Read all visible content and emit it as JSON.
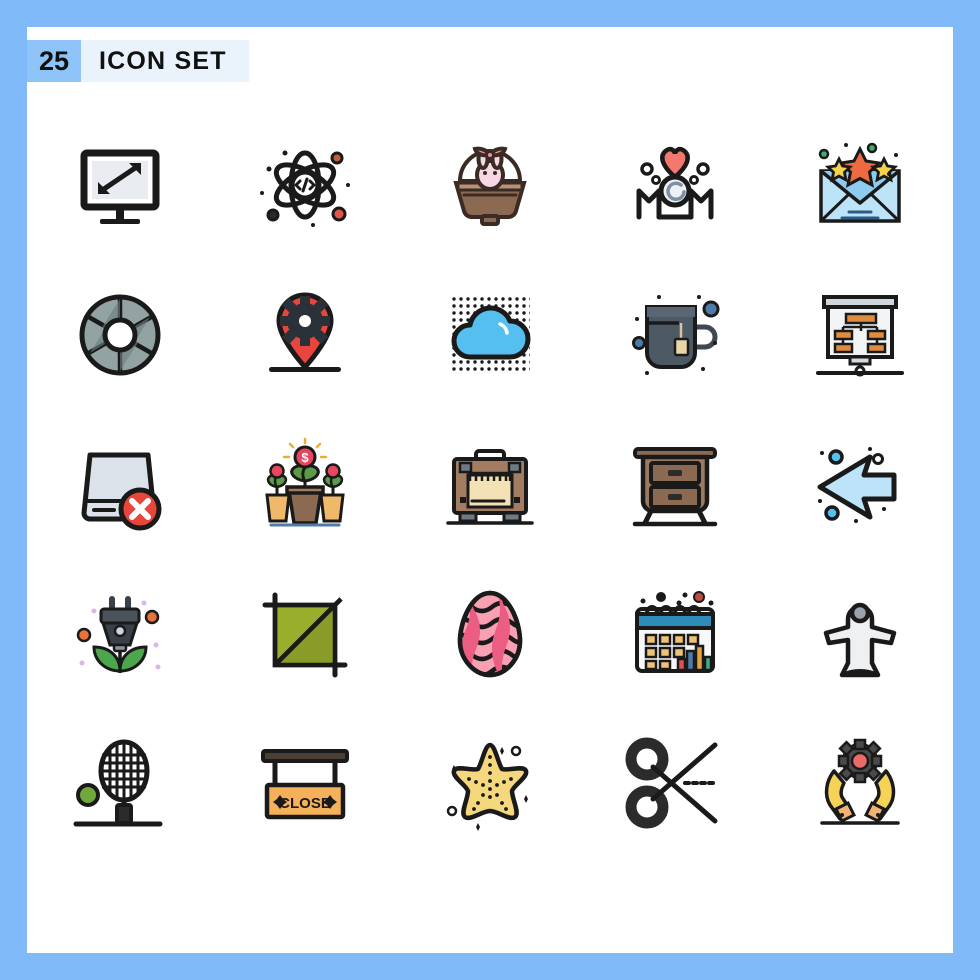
{
  "header": {
    "count": "25",
    "title": "ICON SET",
    "badge_bg": "#8FC4F8",
    "title_bg": "#EAF3FC",
    "text_color": "#111111"
  },
  "frame": {
    "border_color": "#7FB9F7",
    "canvas_color": "#FFFFFF",
    "border_width_px": 27
  },
  "palette": {
    "outline": "#1A1A1A",
    "red": "#E8453C",
    "coral": "#F4786E",
    "pink": "#F28FA0",
    "pink_light": "#F7AFBD",
    "blue_light": "#BDE3F8",
    "blue": "#55BFF0",
    "blue_mid": "#8ECBEE",
    "blue_steel": "#4E7BA8",
    "green": "#4CA64C",
    "olive": "#9AAE2E",
    "yellow": "#F5D77E",
    "orange": "#F5B05A",
    "orange_dark": "#D97B29",
    "brown": "#8C6A52",
    "brown_light": "#B89177",
    "tan": "#F3E2B6",
    "grey": "#8A9A9A",
    "grey_light": "#DDE3EA",
    "grey_dark": "#4A5560",
    "white": "#FFFFFF"
  },
  "grid": {
    "rows": 5,
    "cols": 5,
    "total": 25
  },
  "icons": [
    {
      "id": "screen-size",
      "name": "monitor-screen-size-icon",
      "row": 1,
      "col": 1
    },
    {
      "id": "atom-code",
      "name": "atom-code-icon",
      "row": 1,
      "col": 2
    },
    {
      "id": "easter-basket",
      "name": "easter-basket-bunny-icon",
      "row": 1,
      "col": 3
    },
    {
      "id": "mom-heart",
      "name": "mom-heart-icon",
      "row": 1,
      "col": 4
    },
    {
      "id": "mail-stars",
      "name": "mail-stars-icon",
      "row": 1,
      "col": 5
    },
    {
      "id": "aperture",
      "name": "camera-aperture-icon",
      "row": 2,
      "col": 1
    },
    {
      "id": "location-gear",
      "name": "location-pin-gear-icon",
      "row": 2,
      "col": 2
    },
    {
      "id": "cloud-dots",
      "name": "cloud-halftone-icon",
      "row": 2,
      "col": 3
    },
    {
      "id": "tea-mug",
      "name": "tea-mug-icon",
      "row": 2,
      "col": 4
    },
    {
      "id": "presentation-chart",
      "name": "presentation-flowchart-icon",
      "row": 2,
      "col": 5
    },
    {
      "id": "drive-delete",
      "name": "hard-drive-delete-icon",
      "row": 3,
      "col": 1
    },
    {
      "id": "money-plant",
      "name": "money-plant-icon",
      "row": 3,
      "col": 2
    },
    {
      "id": "toolbox",
      "name": "toolbox-case-icon",
      "row": 3,
      "col": 3
    },
    {
      "id": "nightstand",
      "name": "nightstand-drawers-icon",
      "row": 3,
      "col": 4
    },
    {
      "id": "arrow-left",
      "name": "arrow-left-icon",
      "row": 3,
      "col": 5
    },
    {
      "id": "eco-plug",
      "name": "eco-power-plug-icon",
      "row": 4,
      "col": 1
    },
    {
      "id": "crop-tool",
      "name": "crop-tool-icon",
      "row": 4,
      "col": 2
    },
    {
      "id": "easter-egg",
      "name": "easter-egg-icon",
      "row": 4,
      "col": 3
    },
    {
      "id": "calendar-chart",
      "name": "calendar-chart-icon",
      "row": 4,
      "col": 4
    },
    {
      "id": "statue-figure",
      "name": "statue-figure-icon",
      "row": 4,
      "col": 5
    },
    {
      "id": "tennis-racket",
      "name": "tennis-racket-icon",
      "row": 5,
      "col": 1
    },
    {
      "id": "close-sign",
      "name": "close-shop-sign-icon",
      "row": 5,
      "col": 2
    },
    {
      "id": "starfish",
      "name": "starfish-icon",
      "row": 5,
      "col": 3
    },
    {
      "id": "scissors",
      "name": "scissors-icon",
      "row": 5,
      "col": 4
    },
    {
      "id": "hands-gear",
      "name": "hands-gear-support-icon",
      "row": 5,
      "col": 5
    }
  ],
  "labels": {
    "close_sign_text": "CLOSE"
  }
}
